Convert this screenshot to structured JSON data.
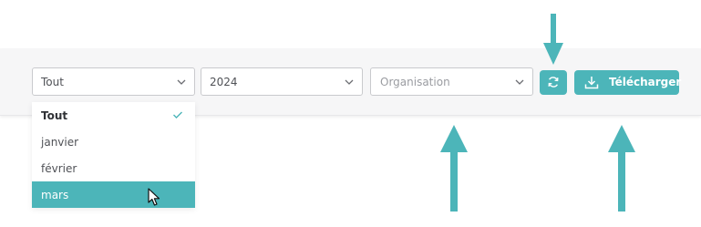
{
  "filters": {
    "period": {
      "value": "Tout"
    },
    "year": {
      "value": "2024"
    },
    "organisation": {
      "placeholder": "Organisation"
    }
  },
  "actions": {
    "refresh_icon": "refresh-icon",
    "download_label": "Télécharger",
    "download_icon": "download-icon"
  },
  "dropdown": {
    "options": [
      "Tout",
      "janvier",
      "février",
      "mars"
    ],
    "selected": "Tout",
    "hovered": "mars"
  },
  "colors": {
    "accent": "#4cb5b9",
    "toolbar_bg": "#f6f6f7",
    "text": "#4f5156",
    "placeholder": "#9a9ca1"
  }
}
